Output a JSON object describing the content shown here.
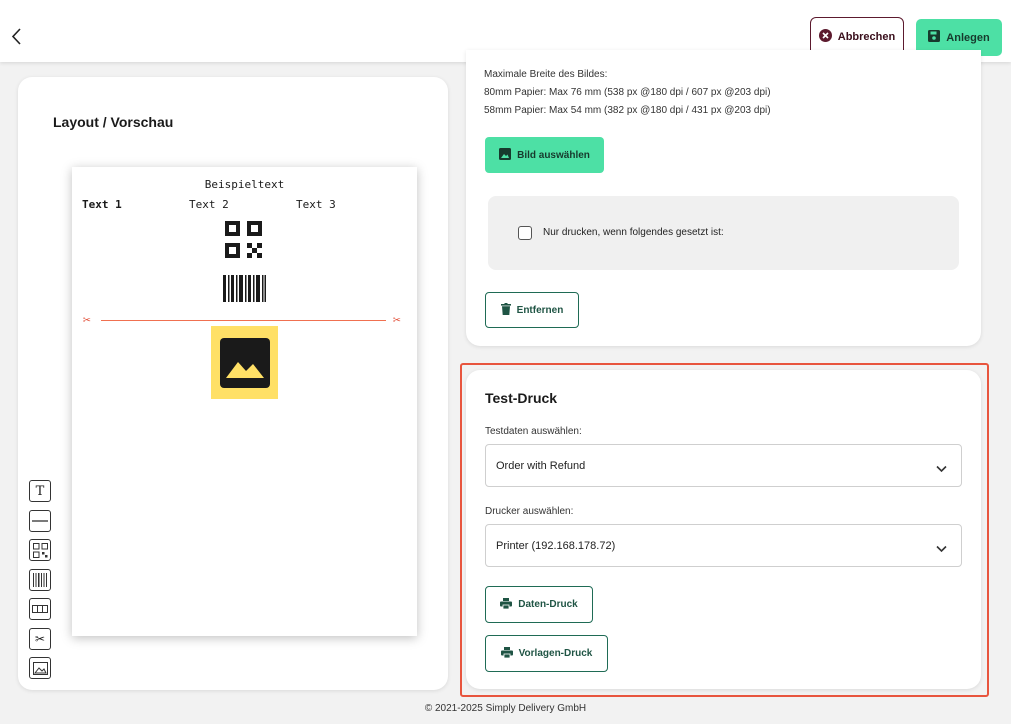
{
  "header": {
    "cancel_label": "Abbrechen",
    "create_label": "Anlegen"
  },
  "layout": {
    "title": "Layout / Vorschau",
    "preview": {
      "example_text": "Beispieltext",
      "columns": [
        "Text 1",
        "Text 2",
        "Text 3"
      ]
    }
  },
  "image_settings": {
    "info_lines": [
      "Maximale Breite des Bildes:",
      "80mm Papier: Max 76 mm (538 px @180 dpi / 607 px @203 dpi)",
      "58mm Papier: Max 54 mm (382 px @180 dpi / 431 px @203 dpi)"
    ],
    "select_image_label": "Bild auswählen",
    "condition_label": "Nur drucken, wenn folgendes gesetzt ist:",
    "condition_checked": false,
    "remove_label": "Entfernen"
  },
  "test_print": {
    "title": "Test-Druck",
    "testdata_label": "Testdaten auswählen:",
    "testdata_value": "Order with Refund",
    "printer_label": "Drucker auswählen:",
    "printer_value": "Printer (192.168.178.72)",
    "data_print_label": "Daten-Druck",
    "template_print_label": "Vorlagen-Druck"
  },
  "footer": {
    "copyright": "© 2021-2025 Simply Delivery GmbH"
  },
  "colors": {
    "accent_green": "#4de0a5",
    "dark_green": "#1f6b55",
    "cancel_border": "#5c1a2e",
    "highlight": "#e8553e",
    "image_placeholder": "#ffe066"
  }
}
